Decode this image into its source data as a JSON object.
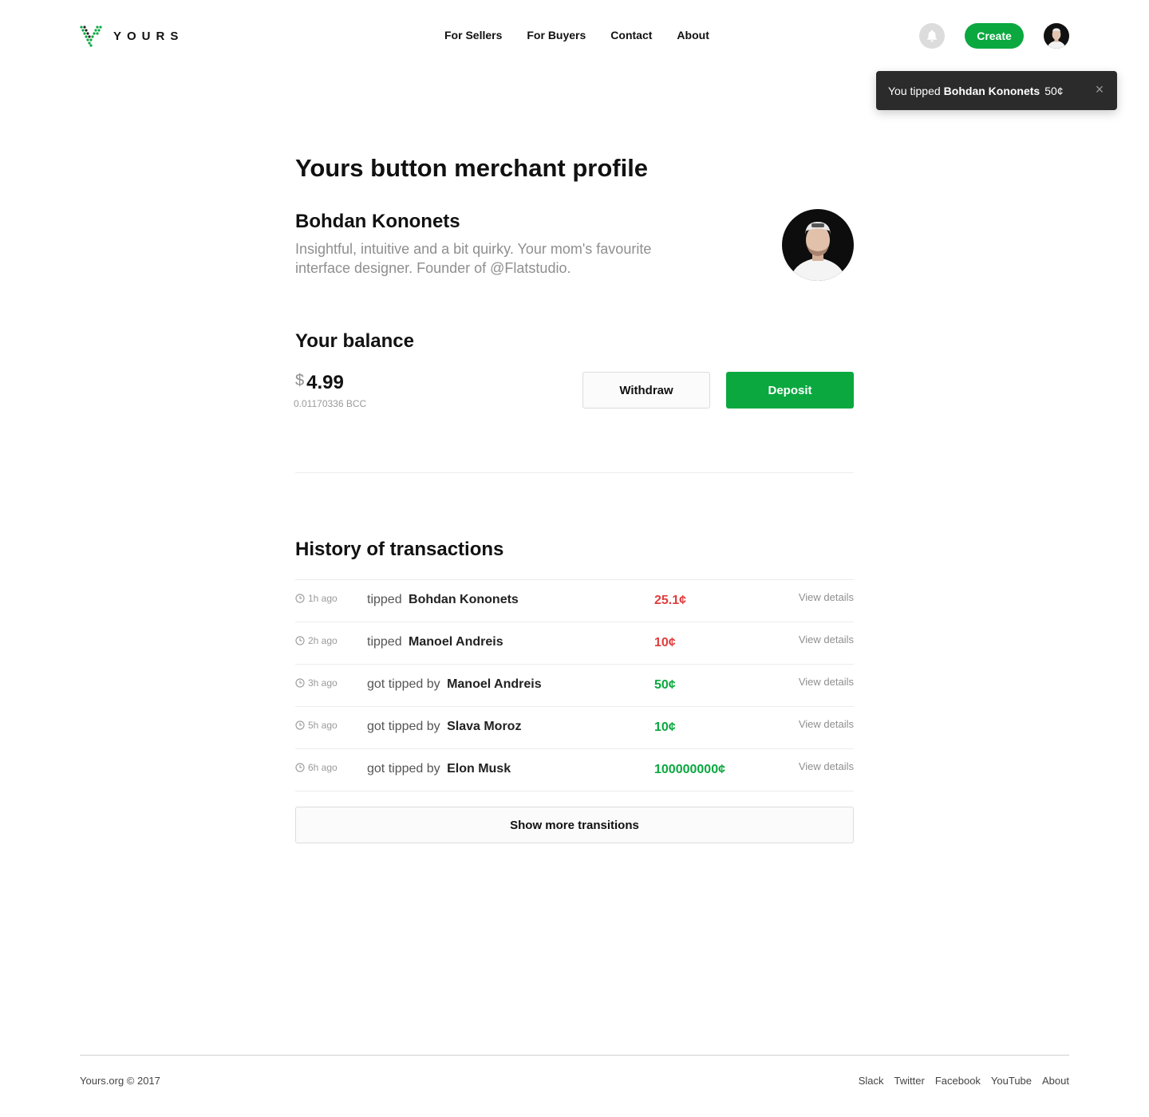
{
  "brand": {
    "name": "YOURS",
    "accent_color": "#0aa83f"
  },
  "nav": {
    "items": [
      {
        "label": "For Sellers"
      },
      {
        "label": "For Buyers"
      },
      {
        "label": "Contact"
      },
      {
        "label": "About"
      }
    ]
  },
  "header": {
    "create_label": "Create",
    "bell_icon": "bell-icon"
  },
  "toast": {
    "prefix": "You tipped",
    "name": "Bohdan Kononets",
    "amount": "50¢",
    "close_icon": "close-icon"
  },
  "page": {
    "title": "Yours button merchant profile"
  },
  "profile": {
    "name": "Bohdan Kononets",
    "bio": "Insightful, intuitive and a bit quirky. Your mom's favourite interface designer. Founder of @Flatstudio."
  },
  "balance": {
    "title": "Your balance",
    "currency_sign": "$",
    "value": "4.99",
    "bcc": "0.01170336 BCC",
    "withdraw_label": "Withdraw",
    "deposit_label": "Deposit"
  },
  "history": {
    "title": "History of transactions",
    "transactions": [
      {
        "time": "1h ago",
        "action": "tipped",
        "name": "Bohdan Kononets",
        "amount": "25.1¢",
        "direction": "out",
        "details": "View details"
      },
      {
        "time": "2h ago",
        "action": "tipped",
        "name": "Manoel Andreis",
        "amount": "10¢",
        "direction": "out",
        "details": "View details"
      },
      {
        "time": "3h ago",
        "action": "got tipped by",
        "name": "Manoel Andreis",
        "amount": "50¢",
        "direction": "in",
        "details": "View details"
      },
      {
        "time": "5h ago",
        "action": "got tipped by",
        "name": "Slava Moroz",
        "amount": "10¢",
        "direction": "in",
        "details": "View details"
      },
      {
        "time": "6h ago",
        "action": "got tipped by",
        "name": "Elon Musk",
        "amount": "100000000¢",
        "direction": "in",
        "details": "View details"
      }
    ],
    "show_more_label": "Show more transitions",
    "colors": {
      "out": "#e03d3d",
      "in": "#0aa83f"
    }
  },
  "footer": {
    "copyright": "Yours.org © 2017",
    "links": [
      {
        "label": "Slack"
      },
      {
        "label": "Twitter"
      },
      {
        "label": "Facebook"
      },
      {
        "label": "YouTube"
      },
      {
        "label": "About"
      }
    ]
  }
}
